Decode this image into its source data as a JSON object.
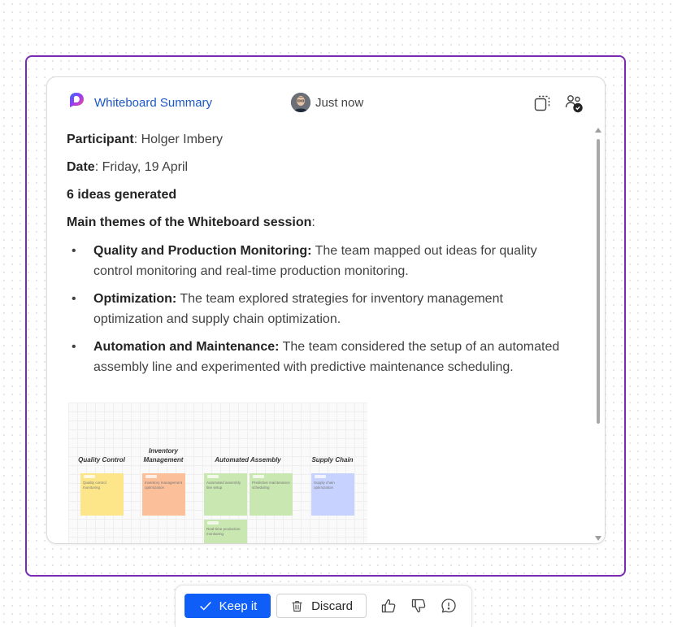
{
  "card": {
    "title": "Whiteboard Summary",
    "timestamp": "Just now"
  },
  "summary": {
    "participant_label": "Participant",
    "participant_value": ": Holger Imbery",
    "date_label": "Date",
    "date_value": ": Friday, 19 April",
    "ideas_count": "6 ideas generated",
    "themes_heading": "Main themes of the Whiteboard session",
    "themes_colon": ":",
    "themes": [
      {
        "title": "Quality and Production Monitoring:",
        "text": " The team mapped out ideas for quality control monitoring and real-time production monitoring."
      },
      {
        "title": "Optimization:",
        "text": " The team explored strategies for inventory management optimization and supply chain optimization."
      },
      {
        "title": "Automation and Maintenance:",
        "text": " The team considered the setup of an automated assembly line and experimented with predictive maintenance scheduling."
      }
    ]
  },
  "thumbnail": {
    "columns": [
      "Quality Control",
      "Inventory\nManagement",
      "Automated Assembly",
      "Supply Chain"
    ],
    "notes": [
      "Quality control monitoring",
      "Inventory management optimization",
      "Automated assembly line setup",
      "Predictive maintenance scheduling",
      "Real-time production monitoring",
      "Supply chain optimization"
    ]
  },
  "toolbar": {
    "keep_label": "Keep it",
    "discard_label": "Discard"
  },
  "icons": {
    "logo": "copilot-logo-icon",
    "copy": "copy-icon",
    "share": "share-people-icon",
    "keep": "checkmark-icon",
    "discard": "trash-icon",
    "like": "thumbs-up-icon",
    "dislike": "thumbs-down-icon",
    "feedback": "feedback-icon"
  },
  "colors": {
    "frame_border": "#7a2bb3",
    "title_link": "#1a57c7",
    "primary_button": "#0f5ef7"
  }
}
